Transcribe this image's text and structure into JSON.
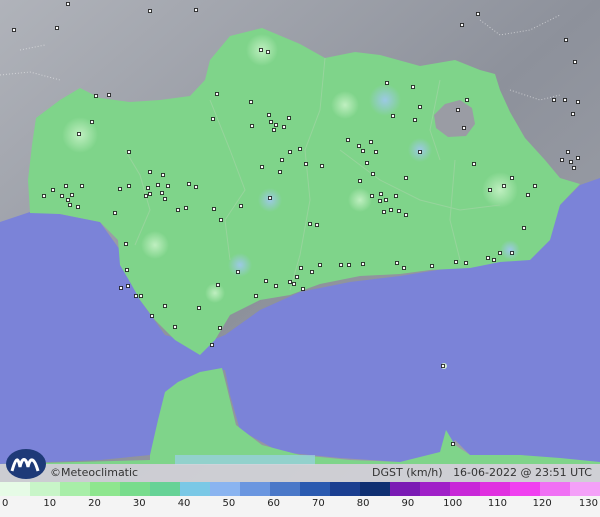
{
  "footer": {
    "brand": "©Meteoclimatic",
    "variable": "DGST (km/h)",
    "datetime": "16-06-2022 @ 23:51 UTC"
  },
  "legend": {
    "ticks": [
      "0",
      "10",
      "20",
      "30",
      "40",
      "50",
      "60",
      "70",
      "80",
      "90",
      "100",
      "110",
      "120",
      "130"
    ],
    "colors": [
      "#e6fbe6",
      "#c8f5c8",
      "#a8eea8",
      "#8ee68e",
      "#78dc8c",
      "#66d296",
      "#7ac8e6",
      "#8ab4f0",
      "#6a96e0",
      "#4a78c8",
      "#2a5ab0",
      "#1a3e90",
      "#103072",
      "#7a1ab4",
      "#a020c8",
      "#c828d8",
      "#e030e0",
      "#f040f0",
      "#f070f4",
      "#f4a0f8"
    ]
  },
  "colors": {
    "land_green": "#7fd48a",
    "sea": "#7b83d8",
    "terrain": "#a3a6ad"
  },
  "stations": [
    [
      68,
      4
    ],
    [
      14,
      30
    ],
    [
      57,
      28
    ],
    [
      150,
      11
    ],
    [
      196,
      10
    ],
    [
      462,
      25
    ],
    [
      478,
      14
    ],
    [
      566,
      40
    ],
    [
      575,
      62
    ],
    [
      261,
      50
    ],
    [
      268,
      52
    ],
    [
      96,
      96
    ],
    [
      109,
      95
    ],
    [
      387,
      83
    ],
    [
      413,
      87
    ],
    [
      393,
      116
    ],
    [
      420,
      107
    ],
    [
      415,
      120
    ],
    [
      458,
      110
    ],
    [
      467,
      100
    ],
    [
      464,
      128
    ],
    [
      217,
      94
    ],
    [
      213,
      119
    ],
    [
      251,
      102
    ],
    [
      252,
      126
    ],
    [
      269,
      115
    ],
    [
      276,
      125
    ],
    [
      284,
      127
    ],
    [
      289,
      118
    ],
    [
      274,
      130
    ],
    [
      271,
      122
    ],
    [
      79,
      134
    ],
    [
      92,
      122
    ],
    [
      129,
      152
    ],
    [
      150,
      172
    ],
    [
      148,
      188
    ],
    [
      158,
      185
    ],
    [
      163,
      175
    ],
    [
      168,
      186
    ],
    [
      162,
      193
    ],
    [
      146,
      196
    ],
    [
      189,
      184
    ],
    [
      196,
      187
    ],
    [
      186,
      208
    ],
    [
      178,
      210
    ],
    [
      214,
      209
    ],
    [
      221,
      220
    ],
    [
      241,
      206
    ],
    [
      270,
      198
    ],
    [
      262,
      167
    ],
    [
      282,
      160
    ],
    [
      280,
      172
    ],
    [
      290,
      152
    ],
    [
      300,
      149
    ],
    [
      306,
      164
    ],
    [
      322,
      166
    ],
    [
      310,
      224
    ],
    [
      317,
      225
    ],
    [
      348,
      140
    ],
    [
      359,
      146
    ],
    [
      363,
      151
    ],
    [
      371,
      142
    ],
    [
      376,
      152
    ],
    [
      367,
      163
    ],
    [
      373,
      174
    ],
    [
      360,
      181
    ],
    [
      372,
      196
    ],
    [
      381,
      194
    ],
    [
      386,
      200
    ],
    [
      384,
      212
    ],
    [
      399,
      211
    ],
    [
      406,
      215
    ],
    [
      391,
      210
    ],
    [
      380,
      201
    ],
    [
      396,
      196
    ],
    [
      406,
      178
    ],
    [
      420,
      152
    ],
    [
      474,
      164
    ],
    [
      490,
      190
    ],
    [
      504,
      186
    ],
    [
      512,
      178
    ],
    [
      528,
      195
    ],
    [
      535,
      186
    ],
    [
      562,
      160
    ],
    [
      568,
      152
    ],
    [
      571,
      162
    ],
    [
      574,
      168
    ],
    [
      578,
      158
    ],
    [
      554,
      100
    ],
    [
      565,
      100
    ],
    [
      578,
      102
    ],
    [
      573,
      114
    ],
    [
      524,
      228
    ],
    [
      488,
      258
    ],
    [
      494,
      260
    ],
    [
      500,
      253
    ],
    [
      512,
      253
    ],
    [
      456,
      262
    ],
    [
      466,
      263
    ],
    [
      432,
      266
    ],
    [
      404,
      268
    ],
    [
      397,
      263
    ],
    [
      363,
      264
    ],
    [
      341,
      265
    ],
    [
      349,
      265
    ],
    [
      320,
      265
    ],
    [
      301,
      268
    ],
    [
      312,
      272
    ],
    [
      297,
      277
    ],
    [
      290,
      282
    ],
    [
      294,
      284
    ],
    [
      303,
      289
    ],
    [
      276,
      286
    ],
    [
      266,
      281
    ],
    [
      256,
      296
    ],
    [
      238,
      272
    ],
    [
      218,
      285
    ],
    [
      220,
      328
    ],
    [
      212,
      345
    ],
    [
      199,
      308
    ],
    [
      165,
      306
    ],
    [
      175,
      327
    ],
    [
      152,
      316
    ],
    [
      136,
      296
    ],
    [
      141,
      296
    ],
    [
      128,
      286
    ],
    [
      127,
      270
    ],
    [
      121,
      288
    ],
    [
      44,
      196
    ],
    [
      53,
      190
    ],
    [
      62,
      196
    ],
    [
      66,
      186
    ],
    [
      68,
      200
    ],
    [
      72,
      195
    ],
    [
      70,
      205
    ],
    [
      78,
      207
    ],
    [
      82,
      186
    ],
    [
      115,
      213
    ],
    [
      126,
      244
    ],
    [
      443,
      366
    ],
    [
      453,
      444
    ],
    [
      120,
      189
    ],
    [
      129,
      186
    ],
    [
      150,
      194
    ],
    [
      165,
      199
    ]
  ]
}
